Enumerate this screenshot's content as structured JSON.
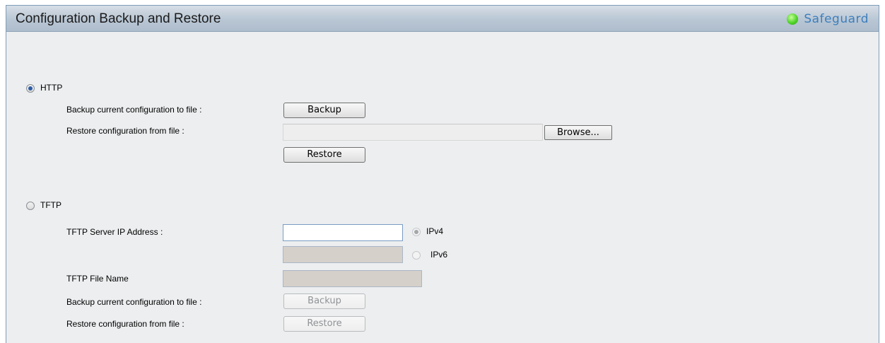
{
  "header": {
    "title": "Configuration Backup and Restore",
    "status_label": "Safeguard"
  },
  "http": {
    "label": "HTTP",
    "selected": true,
    "backup_label": "Backup current configuration to file :",
    "backup_button": "Backup",
    "restore_label": "Restore configuration from file :",
    "restore_file_value": "",
    "browse_button": "Browse...",
    "restore_button": "Restore"
  },
  "tftp": {
    "label": "TFTP",
    "selected": false,
    "server_ip_label": "TFTP Server IP Address :",
    "ipv4_value": "",
    "ipv4_label": "IPv4",
    "ipv6_value": "",
    "ipv6_label": "IPv6",
    "file_name_label": "TFTP File Name",
    "file_name_value": "",
    "backup_label": "Backup current configuration to file :",
    "backup_button": "Backup",
    "restore_label": "Restore configuration from file :",
    "restore_button": "Restore"
  },
  "colors": {
    "title_bar": "#b9c6d4",
    "panel_bg": "#eceeef",
    "status_led": "#51d42a",
    "status_text": "#3d7fbc"
  }
}
